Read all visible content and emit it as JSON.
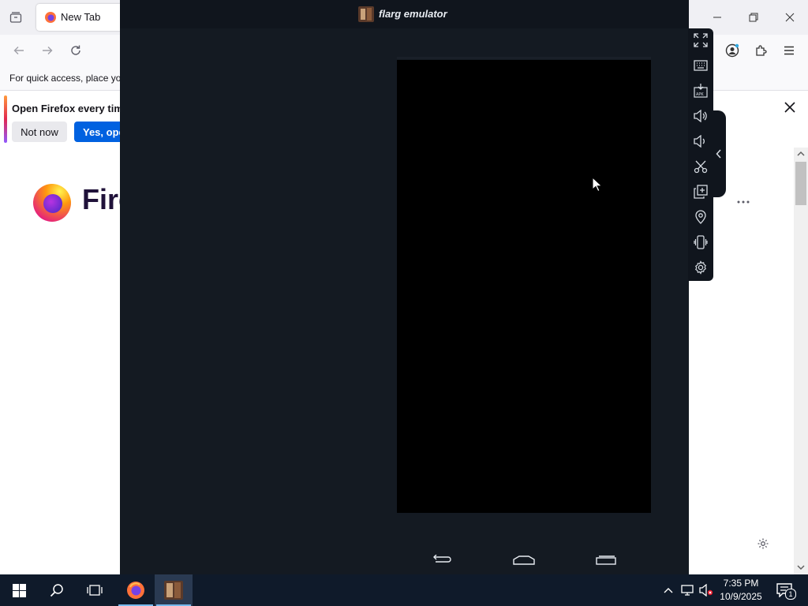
{
  "firefox": {
    "tab_title": "New Tab",
    "bookmarks_hint": "For quick access, place your bookmarks here on the bookmarks toolbar.",
    "notification": {
      "message": "Open Firefox every time you start your computer?",
      "not_now_label": "Not now",
      "yes_label": "Yes, open"
    },
    "wordmark": "Firefox"
  },
  "emulator": {
    "title": "flarg emulator",
    "toolbar_icons": [
      "fullscreen-icon",
      "keyboard-icon",
      "apk-install-icon",
      "volume-up-icon",
      "volume-down-icon",
      "screenshot-scissors-icon",
      "multi-instance-icon",
      "location-icon",
      "shake-icon",
      "settings-icon"
    ]
  },
  "taskbar": {
    "time": "7:35 PM",
    "date": "10/9/2025",
    "notification_count": "1"
  },
  "colors": {
    "emulator_bg": "#141a22",
    "taskbar_bg": "#0f1a2a",
    "firefox_blue": "#0061e0"
  }
}
